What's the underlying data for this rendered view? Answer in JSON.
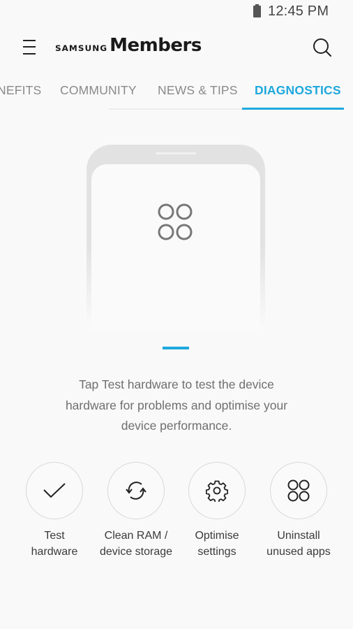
{
  "status_bar": {
    "battery_icon": "battery-icon",
    "time": "12:45 PM"
  },
  "app_bar": {
    "menu_icon": "hamburger-menu-icon",
    "brand_prefix": "SAMSUNG",
    "brand_name": "Members",
    "search_icon": "search-icon"
  },
  "tabs": {
    "items": [
      {
        "label": "NEFITS",
        "active": false
      },
      {
        "label": "COMMUNITY",
        "active": false
      },
      {
        "label": "NEWS & TIPS",
        "active": false
      },
      {
        "label": "DIAGNOSTICS",
        "active": true
      }
    ],
    "accent_color": "#1fa8dd"
  },
  "illustration": {
    "icon": "apps-grid-icon"
  },
  "pager": {
    "pages": 1,
    "current": 1
  },
  "description": {
    "line1": "Tap Test hardware to test the device",
    "line2": "hardware for problems and optimise your",
    "line3": "device performance."
  },
  "actions": [
    {
      "icon": "checkmark-icon",
      "line1": "Test",
      "line2": "hardware"
    },
    {
      "icon": "refresh-icon",
      "line1": "Clean RAM /",
      "line2": "device storage"
    },
    {
      "icon": "gear-icon",
      "line1": "Optimise",
      "line2": "settings"
    },
    {
      "icon": "apps-grid-icon",
      "line1": "Uninstall",
      "line2": "unused apps"
    }
  ]
}
